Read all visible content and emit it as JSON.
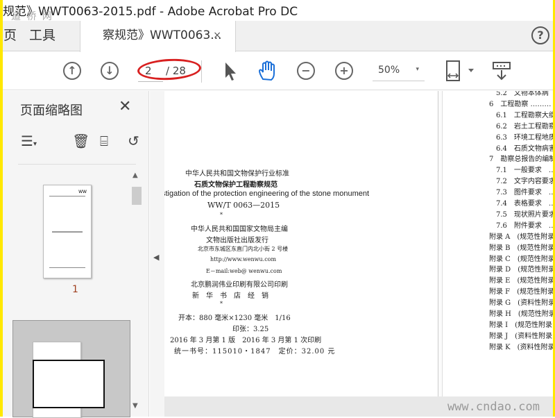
{
  "window": {
    "title": "规范》WWT0063-2015.pdf - Adobe Acrobat Pro DC",
    "watermark_top": "道 桥 网"
  },
  "tabs": {
    "home": "页",
    "tools": "工具",
    "document": "察规范》WWT0063...",
    "close": "×",
    "help": "?"
  },
  "toolbar": {
    "page_current": "2",
    "page_total": "/ 28",
    "zoom": "50%",
    "zoom_arrow": "▾"
  },
  "left_panel": {
    "title": "页面缩略图",
    "close": "✕",
    "thumb_1_label": "1",
    "thumb_1_header": "WW"
  },
  "page1": {
    "lines": [
      "中华人民共和国文物保护行业标准",
      "石质文物保护工程勘察规范",
      "stigation of the protection engineering of the stone monument",
      "WW/T 0063—2015",
      "*",
      "中华人民共和国国家文物局主编",
      "文物出版社出版发行",
      "北京市东城区东直门内北小街 2 号楼",
      "http://www.wenwu.com",
      "E－mail:web@ wenwu.com",
      "北京鹏润伟业印刷有限公司印刷",
      "新　华　书　店　经　销",
      "*",
      "开本：880 毫米×1230 毫米　1/16",
      "印张：3.25",
      "2016 年 3 月第 1 版　2016 年 3 月第 1 次印刷",
      "统一书号：115010・1847　定价：32.00 元"
    ]
  },
  "page2": {
    "toc": [
      "5.2　文物本体病",
      "6　工程勘察 ………",
      "6.1　工程勘察大纲",
      "6.2　岩土工程勘察",
      "6.3　环境工程地质",
      "6.4　石质文物病害",
      "7　勘察总报告的编制",
      "7.1　一般要求　…",
      "7.2　文字内容要求",
      "7.3　图件要求　…",
      "7.4　表格要求　…",
      "7.5　现状照片要求",
      "7.6　附件要求　…",
      "附录 A　(规范性附录",
      "附录 B　(规范性附录",
      "附录 C　(规范性附录",
      "附录 D　(规范性附录",
      "附录 E　(规范性附录",
      "附录 F　(规范性附录",
      "附录 G　(资料性附录",
      "附录 H　(规范性附录",
      "附录 I　(规范性附录",
      "附录 J　(资料性附录",
      "附录 K　(资料性附录"
    ]
  },
  "watermark_bottom": "www.cndao.com",
  "colors": {
    "highlight_circle": "#d82020",
    "hand_tool": "#1a6fd8",
    "border": "#ffe800"
  }
}
